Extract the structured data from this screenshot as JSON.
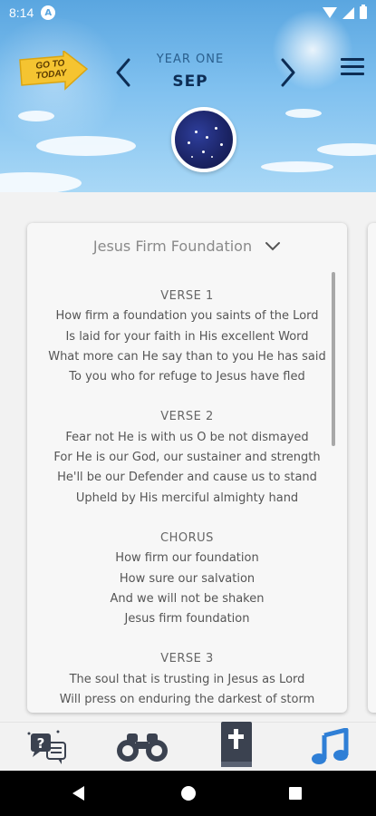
{
  "status_bar": {
    "time": "8:14",
    "app_badge": "A"
  },
  "header": {
    "go_to_today": "GO TO TODAY",
    "year_label": "YEAR ONE",
    "month_label": "SEP"
  },
  "song": {
    "title": "Jesus Firm Foundation",
    "sections": [
      {
        "label": "VERSE 1",
        "lines": [
          "How firm a foundation you saints of the Lord",
          "Is laid for your faith in His excellent Word",
          "What more can He say than to you He has said",
          "To you who for refuge to Jesus have fled"
        ]
      },
      {
        "label": "VERSE 2",
        "lines": [
          "Fear not He is with us O be not dismayed",
          "For He is our God, our sustainer and strength",
          "He'll be our Defender and cause us to stand",
          "Upheld by His merciful almighty hand"
        ]
      },
      {
        "label": "CHORUS",
        "lines": [
          "How firm our foundation",
          "How sure our salvation",
          "And we will not be shaken",
          "Jesus firm foundation"
        ]
      },
      {
        "label": "VERSE 3",
        "lines": [
          "The soul that is trusting in Jesus as Lord",
          "Will press on enduring the darkest of storm"
        ]
      }
    ]
  },
  "bottom_nav": {
    "items": [
      {
        "icon": "question-chat-icon"
      },
      {
        "icon": "binoculars-icon"
      },
      {
        "icon": "bible-icon"
      },
      {
        "icon": "music-note-icon",
        "active": true
      }
    ],
    "active_color": "#2f7fd6",
    "inactive_color": "#3b4250"
  }
}
